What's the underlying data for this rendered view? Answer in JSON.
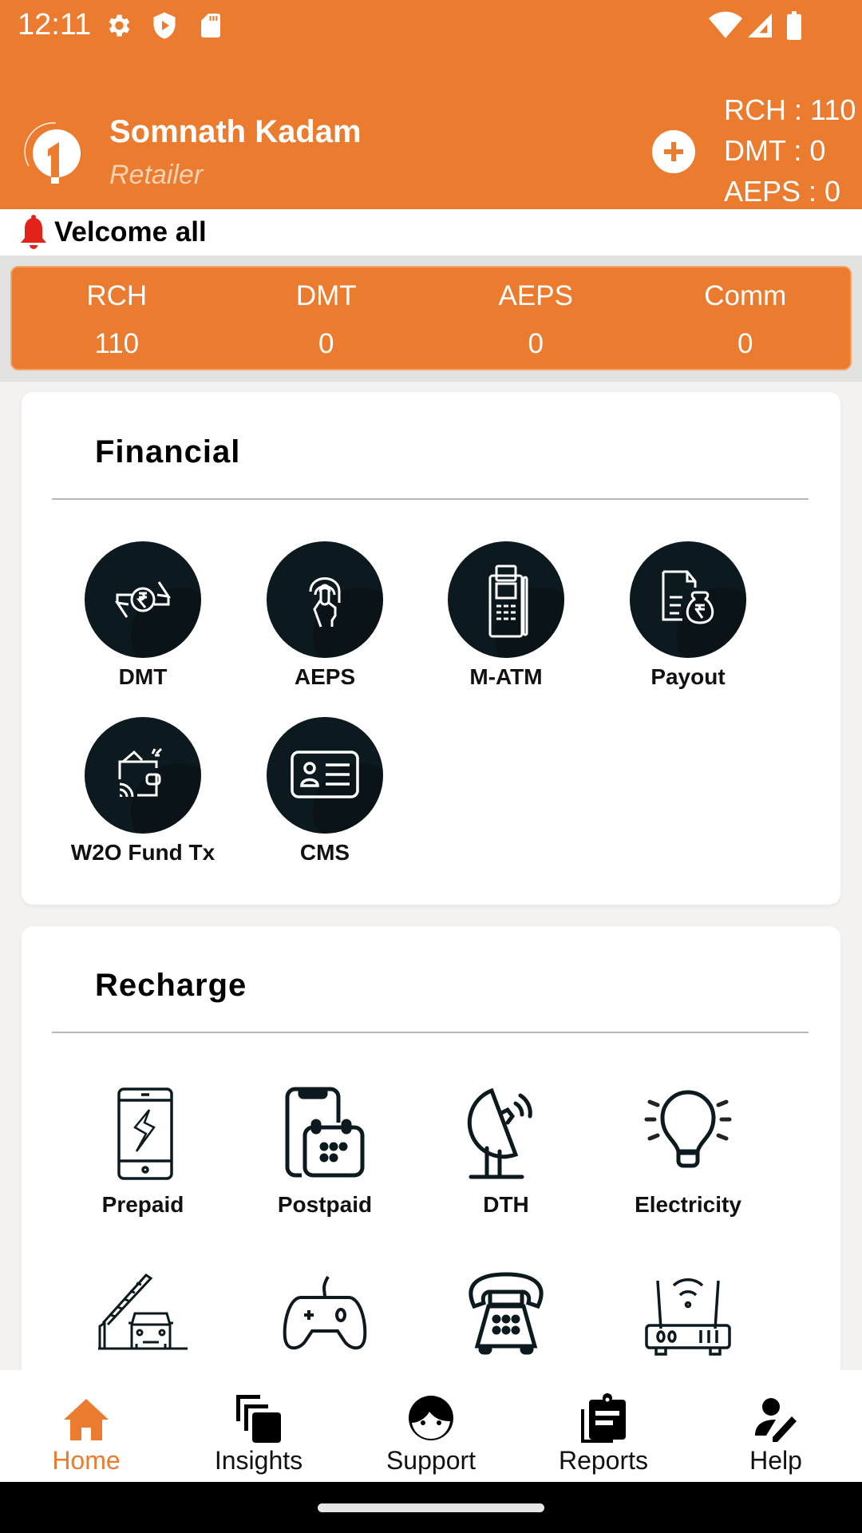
{
  "status_bar": {
    "time": "12:11",
    "left_icons": [
      "gear-icon",
      "shield-play-icon",
      "sd-card-icon"
    ],
    "right_icons": [
      "wifi-icon",
      "signal-icon",
      "battery-icon"
    ]
  },
  "header": {
    "user_name": "Somnath Kadam",
    "user_role": "Retailer",
    "add_button": "add-icon",
    "balances": [
      "RCH : 110",
      "DMT : 0",
      "AEPS : 0"
    ]
  },
  "notice": {
    "text": "Velcome all"
  },
  "stats": [
    {
      "label": "RCH",
      "value": "110"
    },
    {
      "label": "DMT",
      "value": "0"
    },
    {
      "label": "AEPS",
      "value": "0"
    },
    {
      "label": "Comm",
      "value": "0"
    }
  ],
  "financial": {
    "title": "Financial",
    "items": [
      {
        "label": "DMT",
        "icon": "money-transfer-icon"
      },
      {
        "label": "AEPS",
        "icon": "fingerprint-icon"
      },
      {
        "label": "M-ATM",
        "icon": "pos-terminal-icon"
      },
      {
        "label": "Payout",
        "icon": "payout-bag-icon"
      },
      {
        "label": "W2O Fund Tx",
        "icon": "wallet-icon"
      },
      {
        "label": "CMS",
        "icon": "id-card-icon"
      }
    ]
  },
  "recharge": {
    "title": "Recharge",
    "items": [
      {
        "label": "Prepaid",
        "icon": "mobile-bolt-icon"
      },
      {
        "label": "Postpaid",
        "icon": "mobile-calendar-icon"
      },
      {
        "label": "DTH",
        "icon": "satellite-dish-icon"
      },
      {
        "label": "Electricity",
        "icon": "lightbulb-icon"
      },
      {
        "label": "",
        "icon": "toll-car-icon"
      },
      {
        "label": "",
        "icon": "gamepad-icon"
      },
      {
        "label": "",
        "icon": "telephone-icon"
      },
      {
        "label": "",
        "icon": "router-icon"
      }
    ]
  },
  "bottom_nav": [
    {
      "label": "Home",
      "icon": "home-icon",
      "active": true
    },
    {
      "label": "Insights",
      "icon": "layers-icon",
      "active": false
    },
    {
      "label": "Support",
      "icon": "face-icon",
      "active": false
    },
    {
      "label": "Reports",
      "icon": "clipboard-icon",
      "active": false
    },
    {
      "label": "Help",
      "icon": "person-edit-icon",
      "active": false
    }
  ],
  "colors": {
    "brand": "#eb7b2e",
    "tile_bg": "#0c1a20",
    "bell": "#e2231a"
  }
}
